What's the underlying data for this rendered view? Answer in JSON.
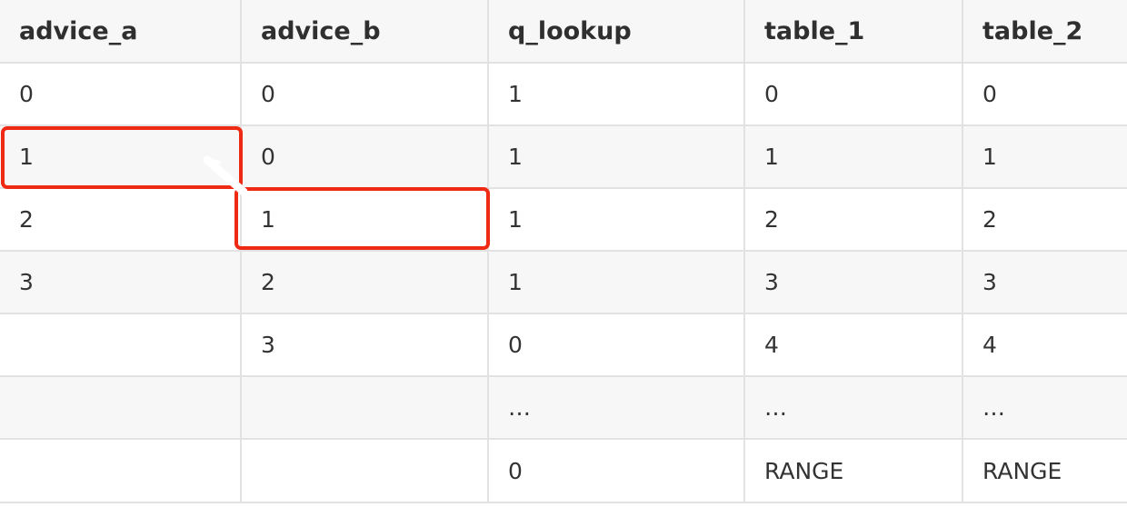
{
  "columns": [
    "advice_a",
    "advice_b",
    "q_lookup",
    "table_1",
    "table_2"
  ],
  "rows": [
    [
      "0",
      "0",
      "1",
      "0",
      "0"
    ],
    [
      "1",
      "0",
      "1",
      "1",
      "1"
    ],
    [
      "2",
      "1",
      "1",
      "2",
      "2"
    ],
    [
      "3",
      "2",
      "1",
      "3",
      "3"
    ],
    [
      "",
      "3",
      "0",
      "4",
      "4"
    ],
    [
      "",
      "",
      "…",
      "…",
      "…"
    ],
    [
      "",
      "",
      "0",
      "RANGE",
      "RANGE"
    ]
  ],
  "colors": {
    "highlight": "#ef2a14",
    "header_bg": "#f7f7f7",
    "stripe_bg": "#f7f7f7",
    "border": "#e2e2e2",
    "text": "#333333"
  }
}
